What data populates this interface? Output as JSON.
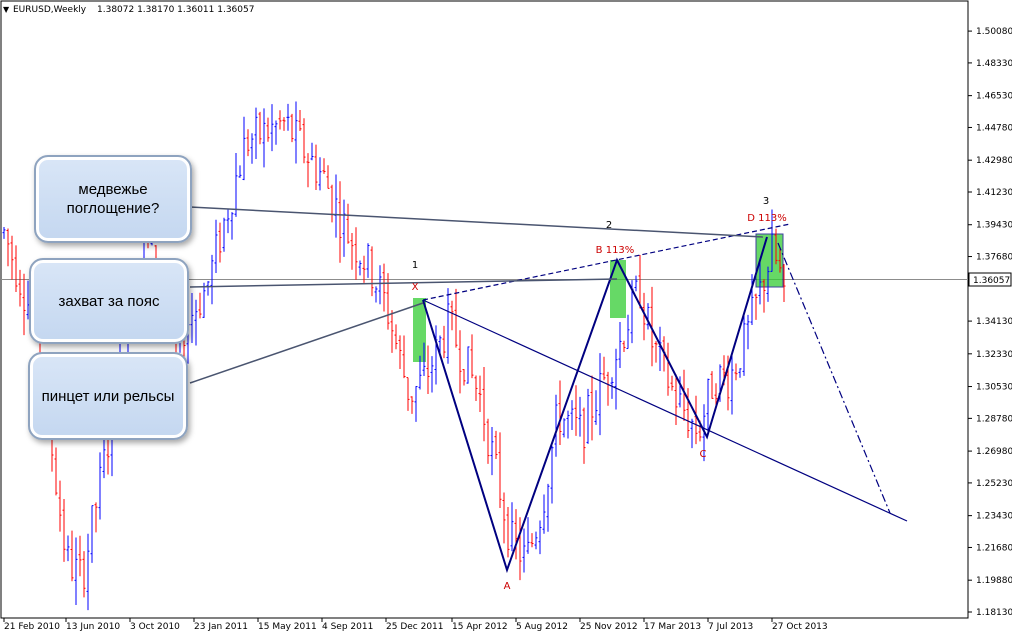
{
  "header": {
    "symbol_label": "EURUSD,Weekly",
    "ohlc": "1.38072 1.38170 1.36011 1.36057"
  },
  "colors": {
    "up": "#0000ff",
    "down": "#ff0000",
    "pattern": "#000080",
    "highlight": "#33cc33",
    "labels": "#cc0000"
  },
  "chart_data": {
    "type": "candlestick",
    "ylim": [
      1.1813,
      1.508
    ],
    "price_ticks": [
      "1.50080",
      "1.48330",
      "1.46530",
      "1.44780",
      "1.42980",
      "1.41230",
      "1.39430",
      "1.37680",
      "1.36057",
      "1.34130",
      "1.32330",
      "1.30530",
      "1.28780",
      "1.26980",
      "1.25230",
      "1.23430",
      "1.21680",
      "1.19880",
      "1.18130"
    ],
    "current_price": 1.36057,
    "date_ticks": [
      "21 Feb 2010",
      "13 Jun 2010",
      "3 Oct 2010",
      "23 Jan 2011",
      "15 May 2011",
      "4 Sep 2011",
      "25 Dec 2011",
      "15 Apr 2012",
      "5 Aug 2012",
      "25 Nov 2012",
      "17 Mar 2013",
      "7 Jul 2013",
      "27 Oct 2013"
    ],
    "anchors": [
      {
        "p": 0.0,
        "v": 1.39
      },
      {
        "p": 0.04,
        "v": 1.34
      },
      {
        "p": 0.08,
        "v": 1.21
      },
      {
        "p": 0.1,
        "v": 1.2
      },
      {
        "p": 0.14,
        "v": 1.29
      },
      {
        "p": 0.18,
        "v": 1.39
      },
      {
        "p": 0.22,
        "v": 1.33
      },
      {
        "p": 0.26,
        "v": 1.36
      },
      {
        "p": 0.31,
        "v": 1.44
      },
      {
        "p": 0.36,
        "v": 1.45
      },
      {
        "p": 0.41,
        "v": 1.42
      },
      {
        "p": 0.44,
        "v": 1.39
      },
      {
        "p": 0.47,
        "v": 1.37
      },
      {
        "p": 0.49,
        "v": 1.35
      },
      {
        "p": 0.52,
        "v": 1.3
      },
      {
        "p": 0.54,
        "v": 1.31
      },
      {
        "p": 0.57,
        "v": 1.34
      },
      {
        "p": 0.61,
        "v": 1.3
      },
      {
        "p": 0.63,
        "v": 1.26
      },
      {
        "p": 0.65,
        "v": 1.22
      },
      {
        "p": 0.67,
        "v": 1.21
      },
      {
        "p": 0.69,
        "v": 1.24
      },
      {
        "p": 0.71,
        "v": 1.29
      },
      {
        "p": 0.74,
        "v": 1.28
      },
      {
        "p": 0.77,
        "v": 1.31
      },
      {
        "p": 0.79,
        "v": 1.33
      },
      {
        "p": 0.815,
        "v": 1.36
      },
      {
        "p": 0.83,
        "v": 1.33
      },
      {
        "p": 0.86,
        "v": 1.3
      },
      {
        "p": 0.89,
        "v": 1.28
      },
      {
        "p": 0.91,
        "v": 1.31
      },
      {
        "p": 0.93,
        "v": 1.31
      },
      {
        "p": 0.95,
        "v": 1.33
      },
      {
        "p": 0.985,
        "v": 1.38
      },
      {
        "p": 1.0,
        "v": 1.36
      }
    ],
    "pattern_points": [
      {
        "label": "X",
        "date": "25 Dec 2011",
        "price": 1.349
      },
      {
        "label": "A",
        "date": "5 Aug 2012",
        "price": 1.206
      },
      {
        "label": "B 113%",
        "date": "25 Nov 2012",
        "price": 1.371
      },
      {
        "label": "C",
        "date": "7 Jul 2013",
        "price": 1.275
      },
      {
        "label": "D 113%",
        "date": "27 Oct 2013",
        "price": 1.382
      }
    ],
    "wave_labels": [
      "1",
      "2",
      "3"
    ],
    "annotations": [
      {
        "id": "bearish_engulfing",
        "text": "медвежье поглощение?"
      },
      {
        "id": "belt_hold",
        "text": "захват за пояс"
      },
      {
        "id": "tweezers_rails",
        "text": "пинцет или рельсы"
      }
    ]
  }
}
